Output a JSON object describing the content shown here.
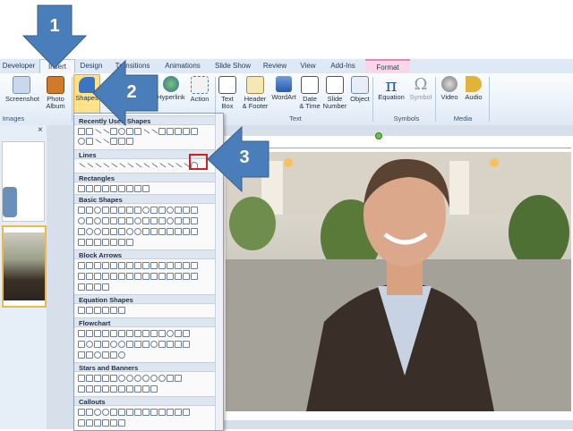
{
  "tabs": [
    {
      "label": "Developer"
    },
    {
      "label": "Insert"
    },
    {
      "label": "Design"
    },
    {
      "label": "Transitions"
    },
    {
      "label": "Animations"
    },
    {
      "label": "Slide Show"
    },
    {
      "label": "Review"
    },
    {
      "label": "View"
    },
    {
      "label": "Add-Ins"
    },
    {
      "label": "Format"
    }
  ],
  "ribbon": {
    "screenshot": "Screenshot",
    "photo_album_l1": "Photo",
    "photo_album_l2": "Album",
    "shapes": "Shapes",
    "hyperlink": "Hyperlink",
    "action": "Action",
    "text_box_l1": "Text",
    "text_box_l2": "Box",
    "header_footer_l1": "Header",
    "header_footer_l2": "& Footer",
    "wordart": "WordArt",
    "date_time_l1": "Date",
    "date_time_l2": "& Time",
    "slide_number_l1": "Slide",
    "slide_number_l2": "Number",
    "object": "Object",
    "equation": "Equation",
    "symbol": "Symbol",
    "video": "Video",
    "audio": "Audio",
    "groups": {
      "images": "Images",
      "text": "Text",
      "symbols": "Symbols",
      "media": "Media"
    }
  },
  "gallery": {
    "sections": [
      "Recently Used Shapes",
      "Lines",
      "Rectangles",
      "Basic Shapes",
      "Block Arrows",
      "Equation Shapes",
      "Flowchart",
      "Stars and Banners",
      "Callouts"
    ]
  },
  "close_glyph": "×",
  "steps": [
    "1",
    "2",
    "3"
  ],
  "colors": {
    "arrow": "#4a7ebb",
    "highlight": "#d21f1f",
    "format_tab": "#f9d7e8"
  }
}
